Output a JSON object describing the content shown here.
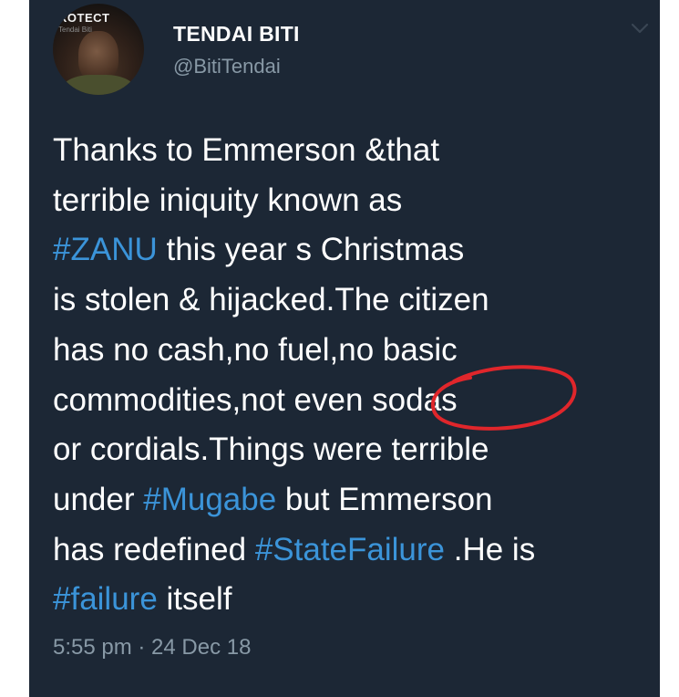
{
  "tweet": {
    "author": {
      "display_name": "TENDAI BITI",
      "handle": "@BitiTendai",
      "avatar_banner_text": "ROTECT",
      "avatar_sub_text": "Tendai Biti"
    },
    "menu_icon": "chevron-down-icon",
    "text_lines": [
      [
        {
          "t": "Thanks to Emmerson &that",
          "tag": false
        }
      ],
      [
        {
          "t": "terrible iniquity known as",
          "tag": false
        }
      ],
      [
        {
          "t": "#ZANU",
          "tag": true
        },
        {
          "t": " this year s Christmas",
          "tag": false
        }
      ],
      [
        {
          "t": "is stolen & hijacked.The citizen",
          "tag": false
        }
      ],
      [
        {
          "t": "has no cash,no fuel,no basic",
          "tag": false
        }
      ],
      [
        {
          "t": "commodities,not even sodas",
          "tag": false
        }
      ],
      [
        {
          "t": "or cordials.Things were terrible",
          "tag": false
        }
      ],
      [
        {
          "t": "under ",
          "tag": false
        },
        {
          "t": "#Mugabe",
          "tag": true
        },
        {
          "t": " but Emmerson",
          "tag": false
        }
      ],
      [
        {
          "t": "has redefined ",
          "tag": false
        },
        {
          "t": "#StateFailure",
          "tag": true
        },
        {
          "t": " .He is",
          "tag": false
        }
      ],
      [
        {
          "t": "#failure",
          "tag": true
        },
        {
          "t": " itself",
          "tag": false
        }
      ]
    ],
    "timestamp": "5:55 pm · 24 Dec 18",
    "annotation": {
      "type": "hand-drawn-circle",
      "color": "#e0262b",
      "target_word": "sodas"
    }
  },
  "colors": {
    "background": "#1c2735",
    "text": "#ffffff",
    "hashtag": "#3b94d9",
    "muted": "#8899a6"
  }
}
